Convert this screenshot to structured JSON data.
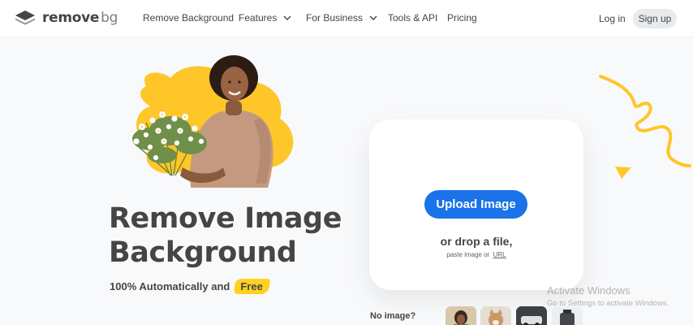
{
  "brand": {
    "name_main": "remove",
    "name_suffix": "bg"
  },
  "nav": {
    "items": [
      {
        "label": "Remove Background",
        "has_dropdown": false
      },
      {
        "label": "Features",
        "has_dropdown": true
      },
      {
        "label": "For Business",
        "has_dropdown": true
      },
      {
        "label": "Tools & API",
        "has_dropdown": false
      },
      {
        "label": "Pricing",
        "has_dropdown": false
      }
    ],
    "login_label": "Log in",
    "signup_label": "Sign up"
  },
  "hero": {
    "headline_line1": "Remove Image",
    "headline_line2": "Background",
    "subline": "100% Automatically and",
    "free_badge": "Free"
  },
  "upload": {
    "button_label": "Upload Image",
    "drop_text": "or drop a file,",
    "paste_text": "paste image or",
    "url_link": "URL"
  },
  "samples": {
    "heading": "No image?",
    "thumbnails": [
      "woman-portrait",
      "dog",
      "car",
      "product"
    ]
  },
  "watermark": {
    "title": "Activate Windows",
    "subtitle": "Go to Settings to activate Windows."
  },
  "colors": {
    "accent_blue": "#1a73e8",
    "brand_yellow": "#ffc629",
    "text_dark": "#454545"
  }
}
